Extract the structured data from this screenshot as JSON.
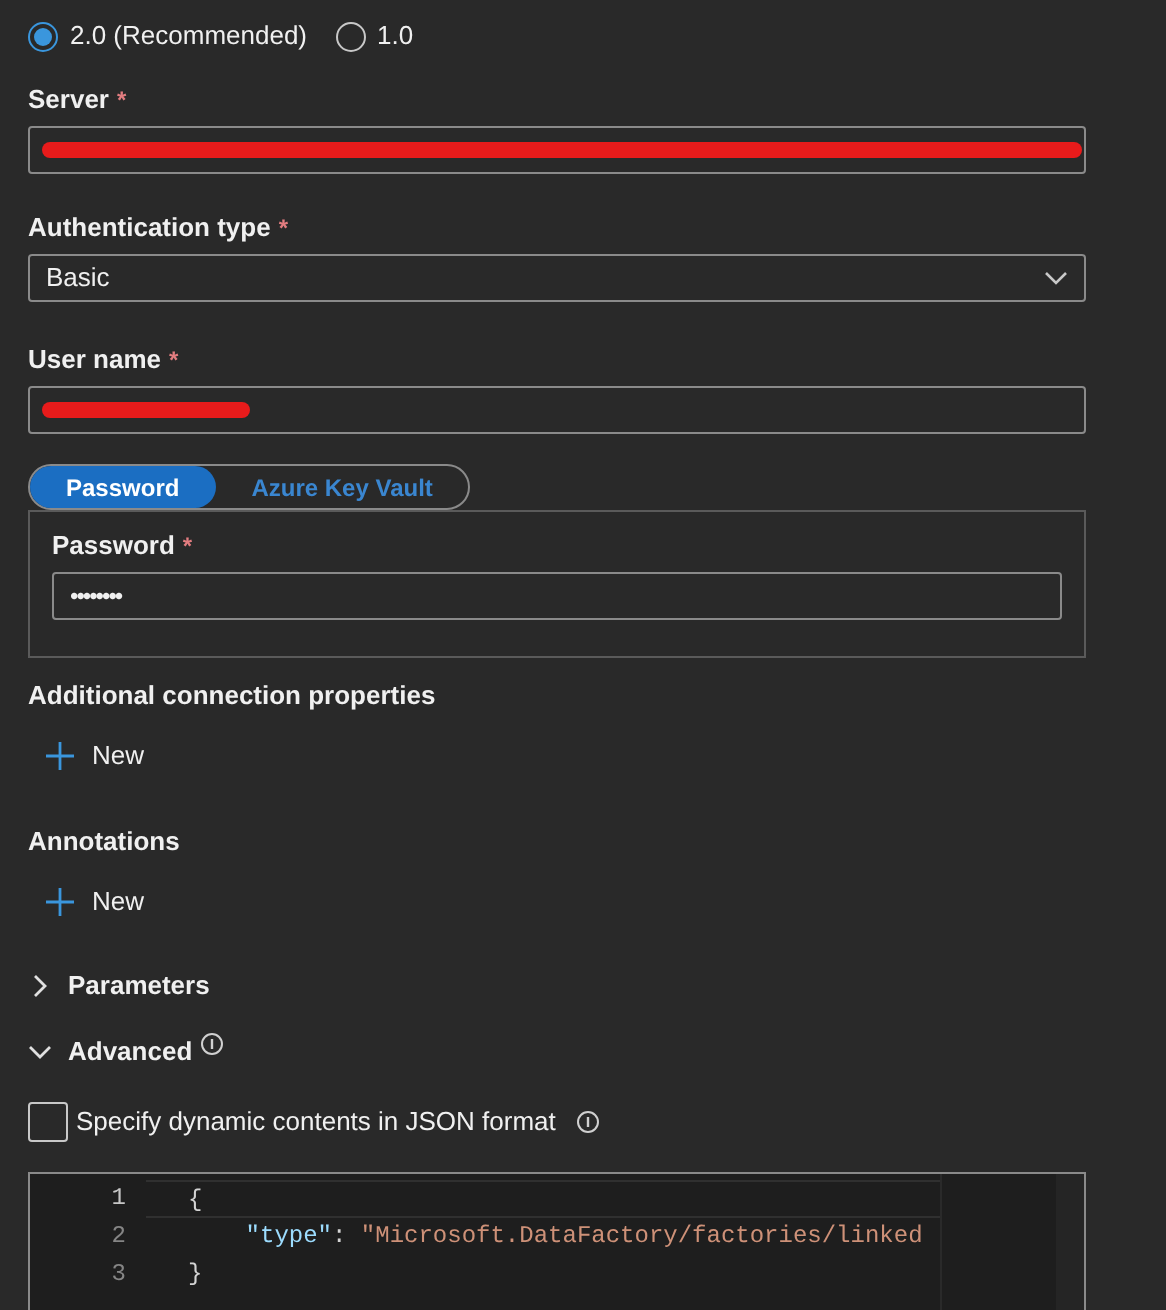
{
  "version_options": [
    {
      "label": "2.0 (Recommended)",
      "selected": true
    },
    {
      "label": "1.0",
      "selected": false
    }
  ],
  "server": {
    "label": "Server",
    "required_mark": "*",
    "redacted": true
  },
  "authentication_type": {
    "label": "Authentication type",
    "required_mark": "*",
    "value": "Basic"
  },
  "user_name": {
    "label": "User name",
    "required_mark": "*",
    "redacted": true
  },
  "credential_tabs": [
    {
      "label": "Password",
      "selected": true
    },
    {
      "label": "Azure Key Vault",
      "selected": false
    }
  ],
  "password": {
    "label": "Password",
    "required_mark": "*",
    "value": "••••••••"
  },
  "additional_connection_properties": {
    "title": "Additional connection properties",
    "button": "New"
  },
  "annotations": {
    "title": "Annotations",
    "button": "New"
  },
  "sections": [
    {
      "label": "Parameters",
      "expanded": false
    },
    {
      "label": "Advanced",
      "expanded": true,
      "info": true
    }
  ],
  "dynamic_contents": {
    "label": "Specify dynamic contents in JSON format",
    "checked": false
  },
  "editor": {
    "lines": [
      {
        "number": "1",
        "tokens": [
          {
            "kind": "punct",
            "text": "{"
          }
        ]
      },
      {
        "number": "2",
        "tokens": [
          {
            "kind": "key",
            "text": "    \"type\""
          },
          {
            "kind": "punct",
            "text": ": "
          },
          {
            "kind": "string",
            "text": "\"Microsoft.DataFactory/factories/linked"
          }
        ]
      },
      {
        "number": "3",
        "tokens": [
          {
            "kind": "punct",
            "text": "}"
          }
        ]
      }
    ]
  }
}
